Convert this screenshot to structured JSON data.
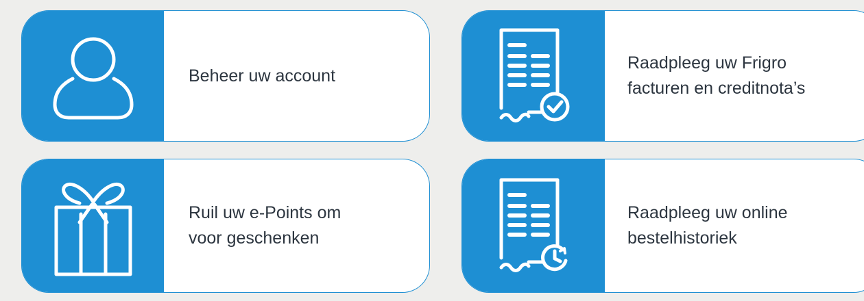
{
  "theme": {
    "accent": "#1e8fd3",
    "text_color": "#2d3640",
    "background": "#eeeeec"
  },
  "cards": [
    {
      "icon": "user-icon",
      "label": "Beheer uw account"
    },
    {
      "icon": "invoice-check-icon",
      "label": "Raadpleeg uw Frigro\nfacturen en creditnota’s"
    },
    {
      "icon": "gift-icon",
      "label": "Ruil uw e-Points om\nvoor geschenken"
    },
    {
      "icon": "order-history-icon",
      "label": "Raadpleeg uw online\nbestelhistoriek"
    }
  ]
}
